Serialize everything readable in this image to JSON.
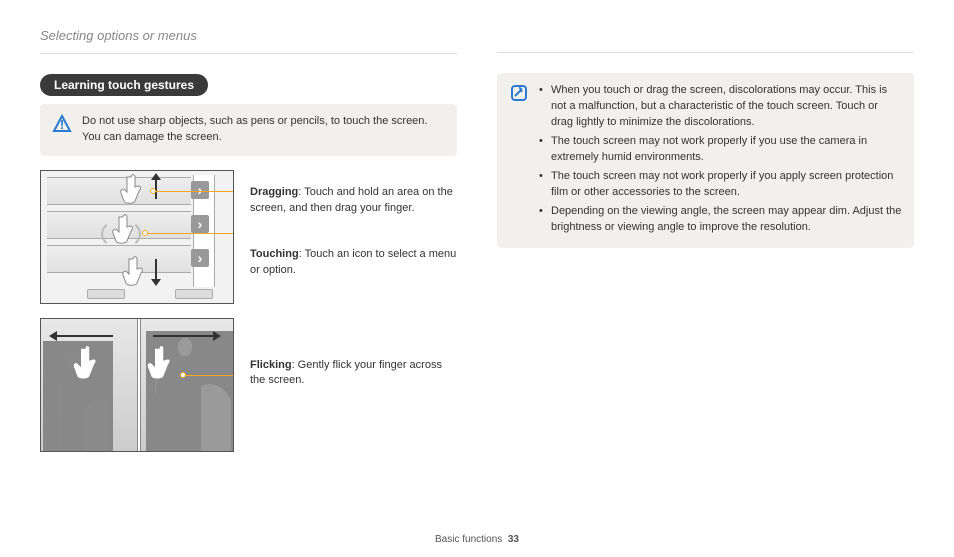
{
  "breadcrumb": "Selecting options or menus",
  "pill": "Learning touch gestures",
  "warning_text": "Do not use sharp objects, such as pens or pencils, to touch the screen. You can damage the screen.",
  "gestures": {
    "dragging_label": "Dragging",
    "dragging_text": ": Touch and hold an area on the screen, and then drag your finger.",
    "touching_label": "Touching",
    "touching_text": ": Touch an icon to select a menu or option.",
    "flicking_label": "Flicking",
    "flicking_text": ": Gently flick your finger across the screen."
  },
  "notes": [
    "When you touch or drag the screen, discolorations may occur. This is not a malfunction, but a characteristic of the touch screen. Touch or drag lightly to minimize the discolorations.",
    "The touch screen may not work properly if you use the camera in extremely humid environments.",
    "The touch screen may not work properly if you apply screen protection film or other accessories to the screen.",
    "Depending on the viewing angle, the screen may appear dim. Adjust the brightness or viewing angle to improve the resolution."
  ],
  "footer": {
    "section": "Basic functions",
    "page": "33"
  }
}
